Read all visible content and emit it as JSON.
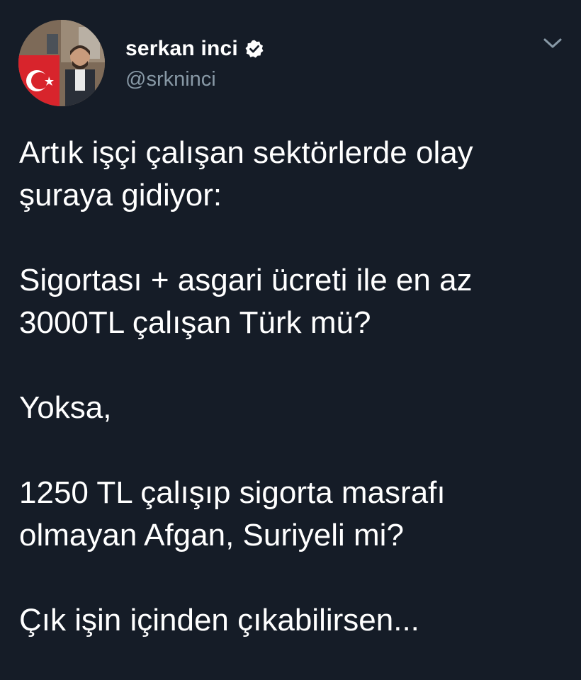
{
  "author": {
    "display_name": "serkan inci",
    "handle": "@srkninci",
    "verified_icon": "verified-badge-icon"
  },
  "menu": {
    "icon": "chevron-down-icon"
  },
  "tweet": {
    "lines": [
      "Artık işçi çalışan sektörlerde olay",
      "şuraya gidiyor:",
      "Sigortası + asgari ücreti ile en az",
      "3000TL çalışan Türk mü?",
      "Yoksa,",
      "1250 TL çalışıp sigorta masrafı",
      "olmayan Afgan, Suriyeli mi?",
      "Çık işin içinden çıkabilirsen..."
    ]
  },
  "colors": {
    "background": "#151c27",
    "text": "#ffffff",
    "secondary_text": "#8899a6"
  }
}
